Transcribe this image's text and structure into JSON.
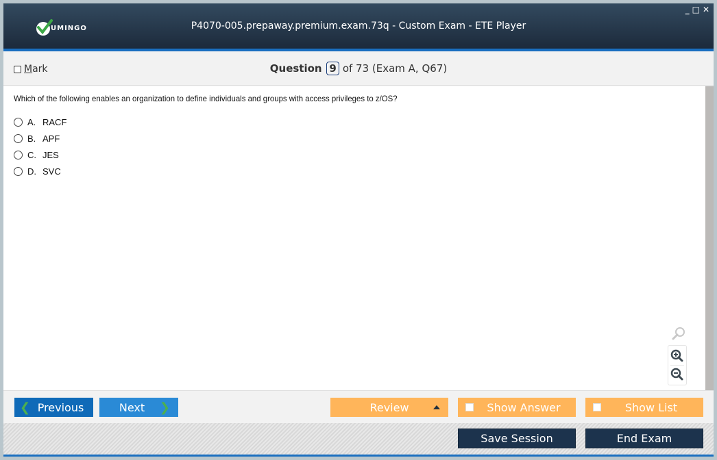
{
  "window": {
    "title": "P4070-005.prepaway.premium.exam.73q - Custom Exam - ETE Player",
    "logo_text": "UMINGO",
    "controls": {
      "minimize": "_",
      "maximize": "□",
      "close": "✕"
    }
  },
  "question_bar": {
    "mark_label_underlined": "M",
    "mark_label_rest": "ark",
    "mark_checked": false,
    "question_label": "Question",
    "question_number": "9",
    "question_of": "of 73 (Exam A, Q67)"
  },
  "question": {
    "text": "Which of the following enables an organization to define individuals and groups with access privileges to z/OS?",
    "options": [
      {
        "letter": "A.",
        "text": "RACF",
        "selected": false
      },
      {
        "letter": "B.",
        "text": "APF",
        "selected": false
      },
      {
        "letter": "C.",
        "text": "JES",
        "selected": false
      },
      {
        "letter": "D.",
        "text": "SVC",
        "selected": false
      }
    ]
  },
  "zoom_tools": {
    "icons": [
      "search-icon",
      "zoom-in-icon",
      "zoom-out-icon"
    ]
  },
  "nav": {
    "previous_label": "Previous",
    "next_label": "Next",
    "review_label": "Review",
    "show_answer_label": "Show Answer",
    "show_list_label": "Show List",
    "save_session_label": "Save Session",
    "end_exam_label": "End Exam"
  },
  "colors": {
    "accent_blue": "#1a6fc0",
    "orange": "#ffb55a",
    "dark_navy": "#1c334d",
    "check_green": "#4caf50"
  }
}
